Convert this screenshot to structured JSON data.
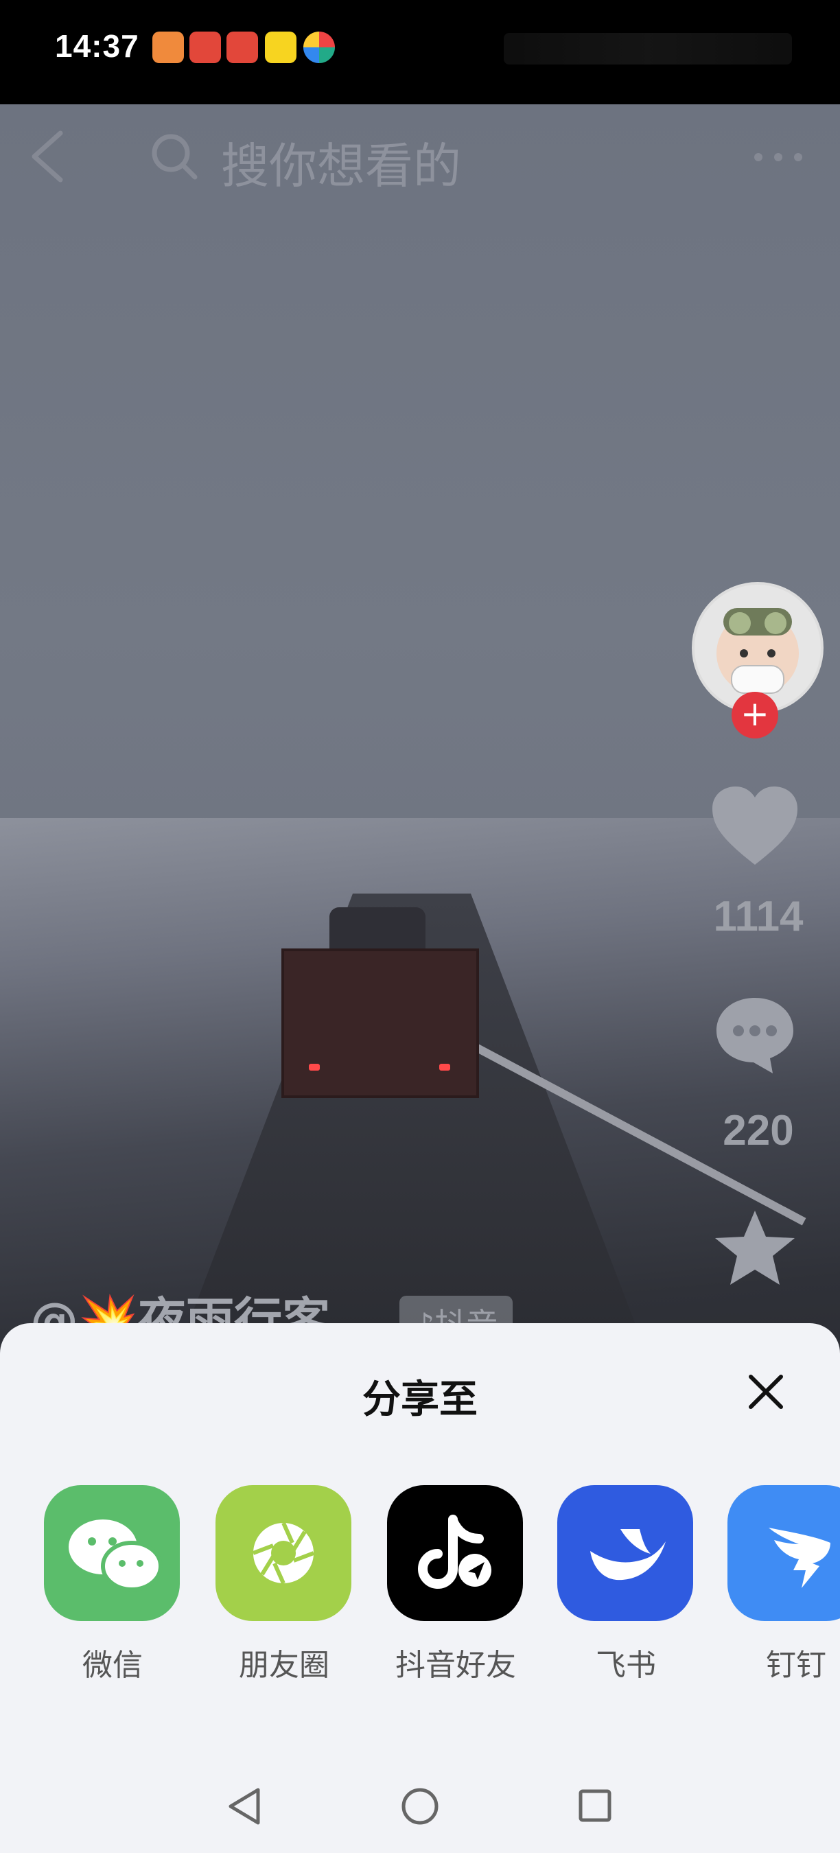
{
  "status_bar": {
    "time": "14:37",
    "notification_icons": [
      "heart-app-icon",
      "red-envelope-icon",
      "red-envelope-icon",
      "game-app-icon",
      "multicolor-app-icon"
    ]
  },
  "top_bar": {
    "search_placeholder": "搜你想看的",
    "icons": [
      "back-icon",
      "search-icon",
      "more-icon"
    ]
  },
  "video": {
    "author": "@💥夜雨行客",
    "platform_tag": "♪抖音",
    "likes": "1114",
    "comments": "220",
    "icons": [
      "heart-icon",
      "comment-icon",
      "star-icon"
    ]
  },
  "share_sheet": {
    "title": "分享至",
    "targets": [
      {
        "label": "微信",
        "icon": "wechat-icon",
        "color": "#5bbd6b"
      },
      {
        "label": "朋友圈",
        "icon": "moments-icon",
        "color": "#a3d04a"
      },
      {
        "label": "抖音好友",
        "icon": "douyin-icon",
        "color": "#000000"
      },
      {
        "label": "飞书",
        "icon": "feishu-icon",
        "color": "#2f5be0"
      },
      {
        "label": "钉钉",
        "icon": "dingtalk-icon",
        "color": "#3f8cf4"
      }
    ]
  },
  "nav_bar": {
    "icons": [
      "nav-back-icon",
      "nav-home-icon",
      "nav-recent-icon"
    ]
  }
}
